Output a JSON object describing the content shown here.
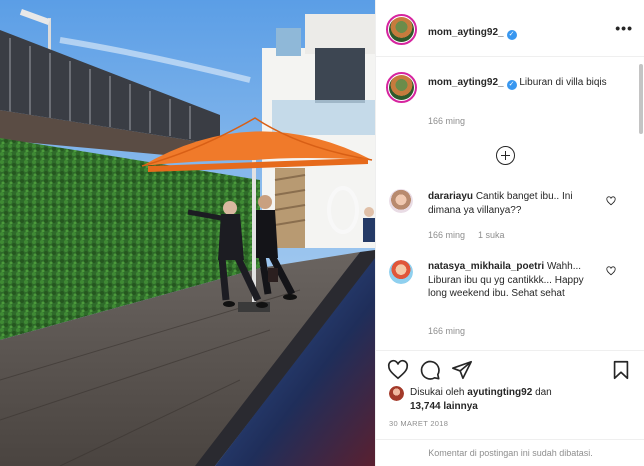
{
  "post": {
    "author": "mom_ayting92_",
    "caption": "Liburan di villa biqis",
    "caption_time": "166 ming"
  },
  "comments": [
    {
      "user": "darariayu",
      "text": "Cantik banget ibu.. Ini dimana ya villanya??",
      "time": "166 ming",
      "likes": "1 suka"
    },
    {
      "user": "natasya_mikhaila_poetri",
      "text": "Wahh... Liburan ibu qu yg cantikkk... Happy long weekend ibu. Sehat sehat",
      "time": "166 ming"
    }
  ],
  "likes": {
    "prefix": "Disukai oleh",
    "first_user": "ayutingting92",
    "connector": "dan",
    "others": "13,744 lainnya"
  },
  "date": "30 MARET 2018",
  "comment_status": "Komentar di postingan ini sudah dibatasi.",
  "colors": {
    "verified": "#3897f0",
    "muted": "#8e8e8e",
    "text": "#262626",
    "border": "#efefef"
  },
  "icons": [
    "more-icon",
    "add-circle-icon",
    "heart-icon",
    "comment-icon",
    "share-icon",
    "bookmark-icon",
    "verified-icon"
  ]
}
